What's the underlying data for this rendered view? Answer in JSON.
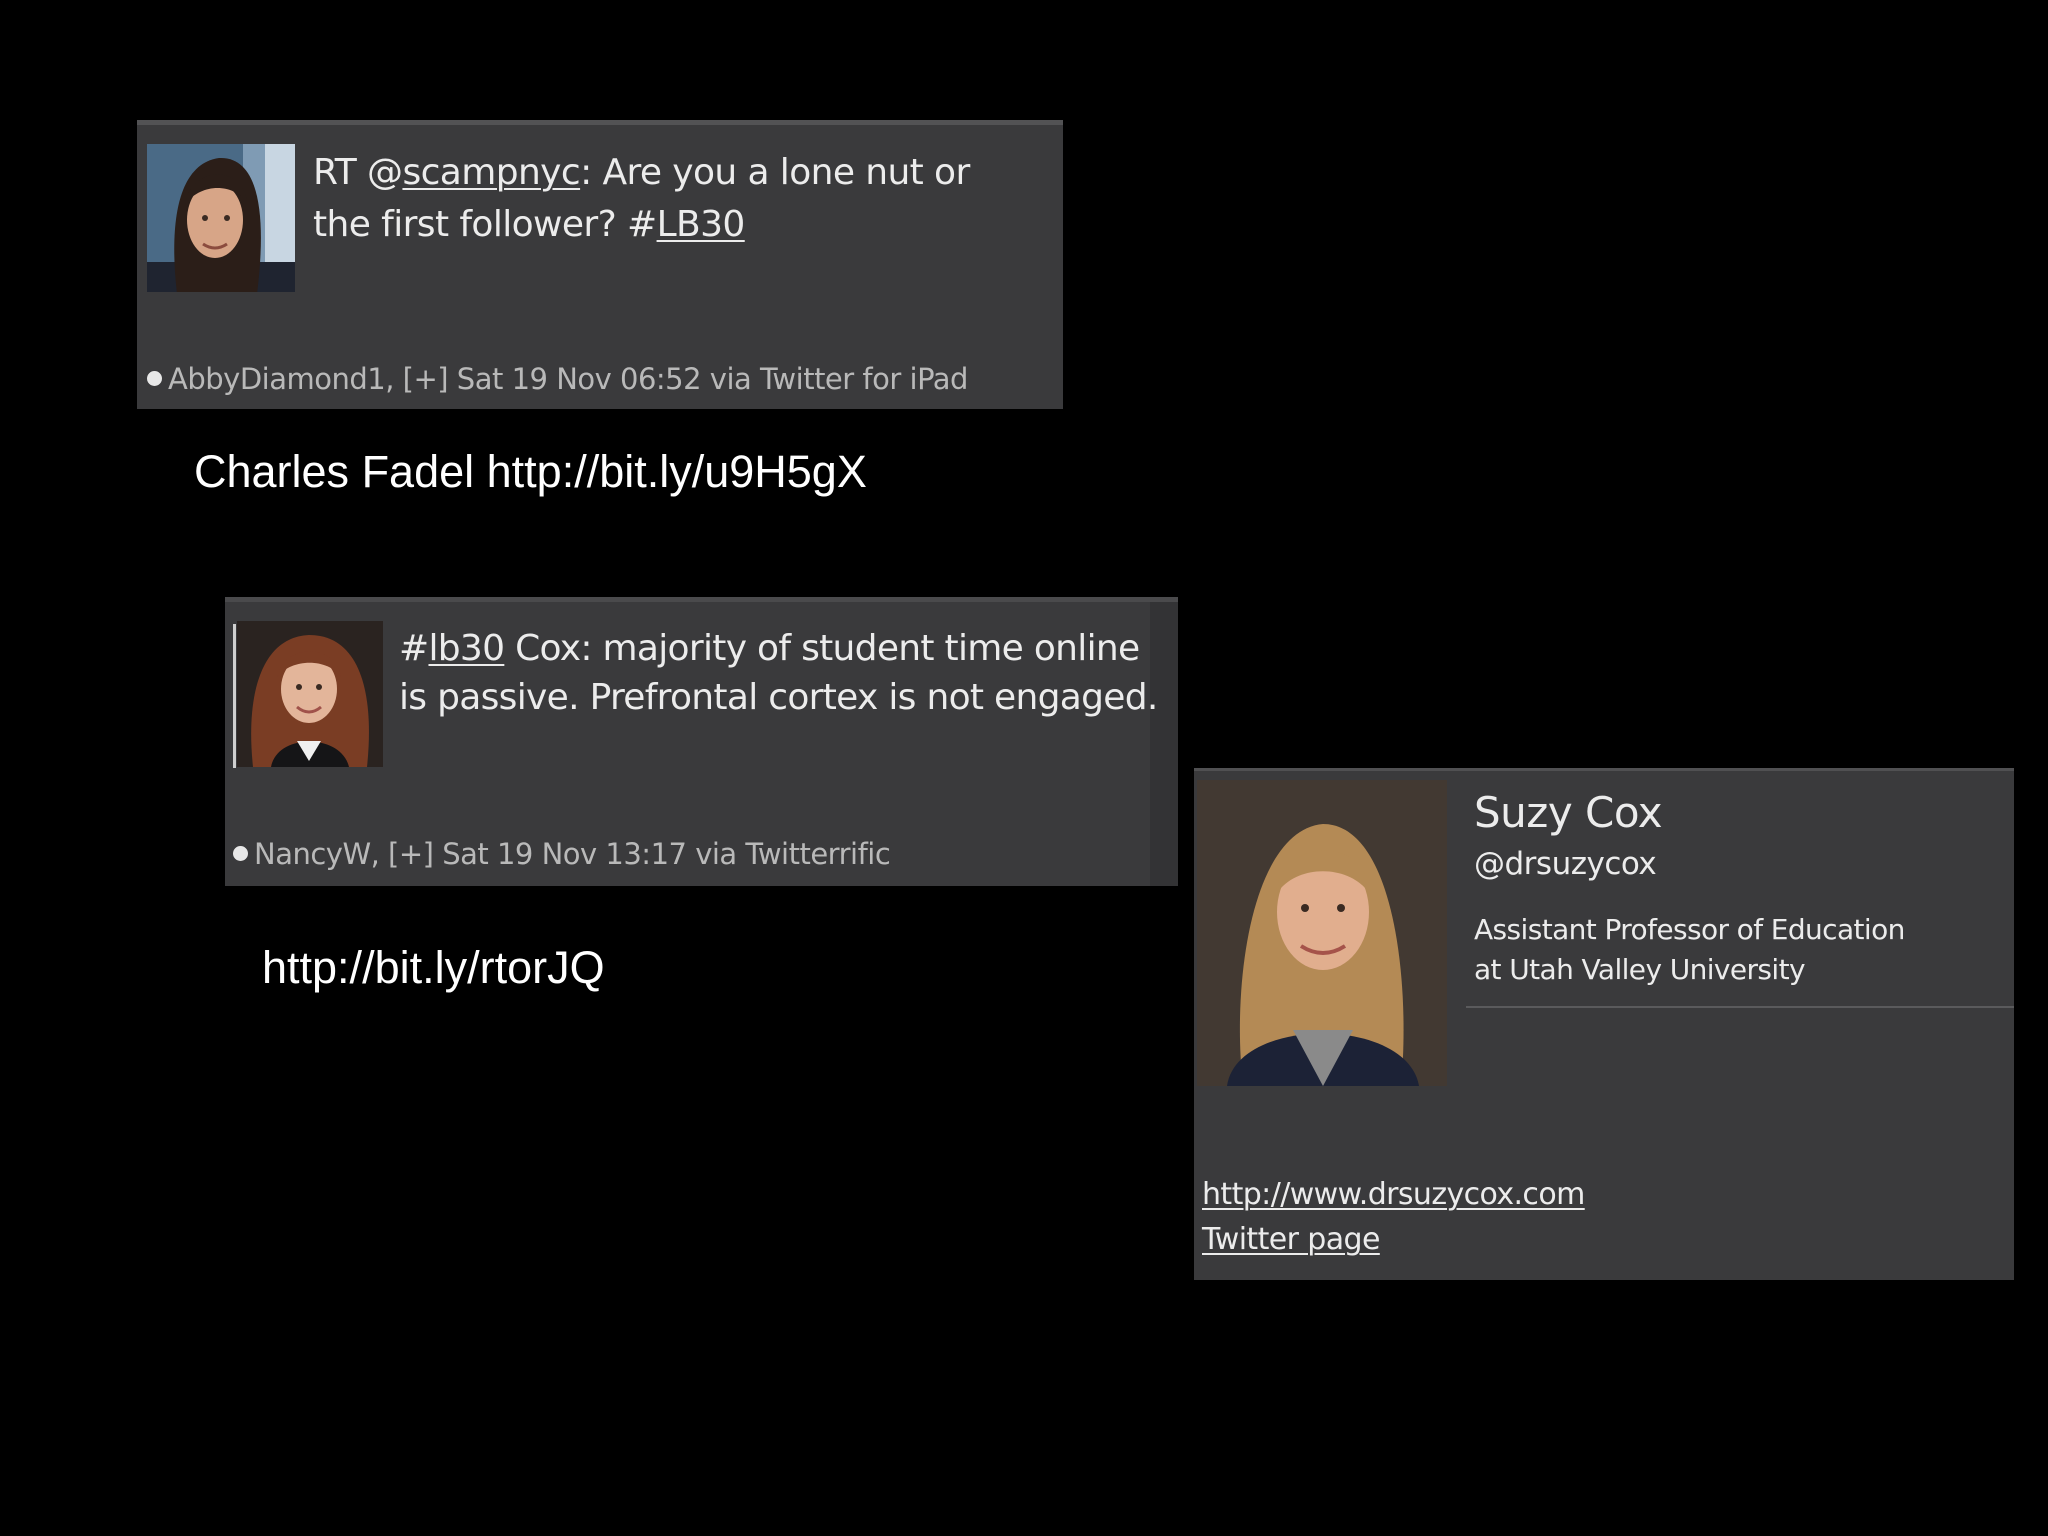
{
  "tweets": [
    {
      "text_prefix": "RT @",
      "mention": "scampnyc",
      "text_middle": ": Are you a lone nut or the first follower? #",
      "hashtag": "LB30",
      "user": "AbbyDiamond1",
      "meta_rest": ", [+] Sat 19 Nov 06:52 via Twitter for iPad"
    },
    {
      "text_prefix": "#",
      "hashtag": "lb30",
      "text_rest": " Cox: majority of student time online is passive. Prefrontal cortex is not engaged.",
      "user": "NancyW",
      "meta_rest": ", [+] Sat 19 Nov 13:17 via Twitterrific"
    }
  ],
  "captions": {
    "first": "Charles Fadel http://bit.ly/u9H5gX",
    "second": "http://bit.ly/rtorJQ"
  },
  "profile": {
    "name": "Suzy Cox",
    "handle": "@drsuzycox",
    "bio_line1": "Assistant Professor of Education",
    "bio_line2": "at Utah Valley University",
    "website": "http://www.drsuzycox.com",
    "twitter_link": "Twitter page"
  },
  "colors": {
    "background": "#000000",
    "card": "#3a3a3c",
    "text": "#ececec",
    "meta": "#b9b9b9"
  }
}
